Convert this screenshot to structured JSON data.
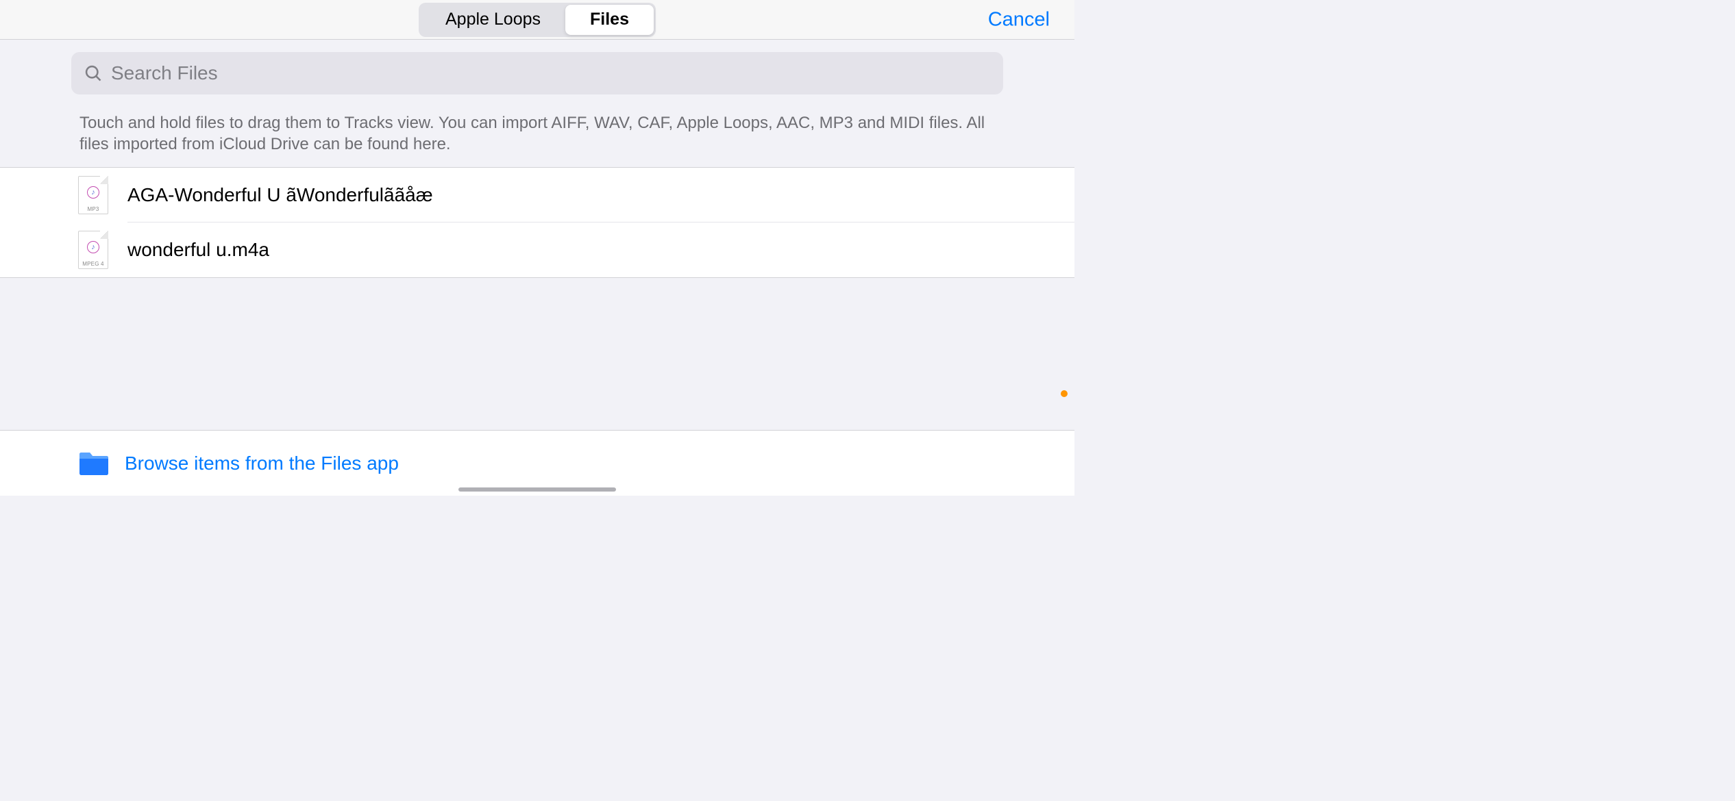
{
  "header": {
    "tabs": [
      {
        "label": "Apple Loops",
        "active": false
      },
      {
        "label": "Files",
        "active": true
      }
    ],
    "cancel_label": "Cancel"
  },
  "search": {
    "placeholder": "Search Files",
    "value": ""
  },
  "help_text": "Touch and hold files to drag them to Tracks view. You can import AIFF, WAV, CAF, Apple Loops, AAC, MP3 and MIDI files. All files imported from iCloud Drive can be found here.",
  "files": [
    {
      "name": "AGA-Wonderful U ãWonderfulããåæ",
      "type_label": "MP3",
      "icon": "audio-file-icon"
    },
    {
      "name": "wonderful u.m4a",
      "type_label": "MPEG 4",
      "icon": "audio-file-icon"
    }
  ],
  "footer": {
    "browse_label": "Browse items from the Files app"
  }
}
